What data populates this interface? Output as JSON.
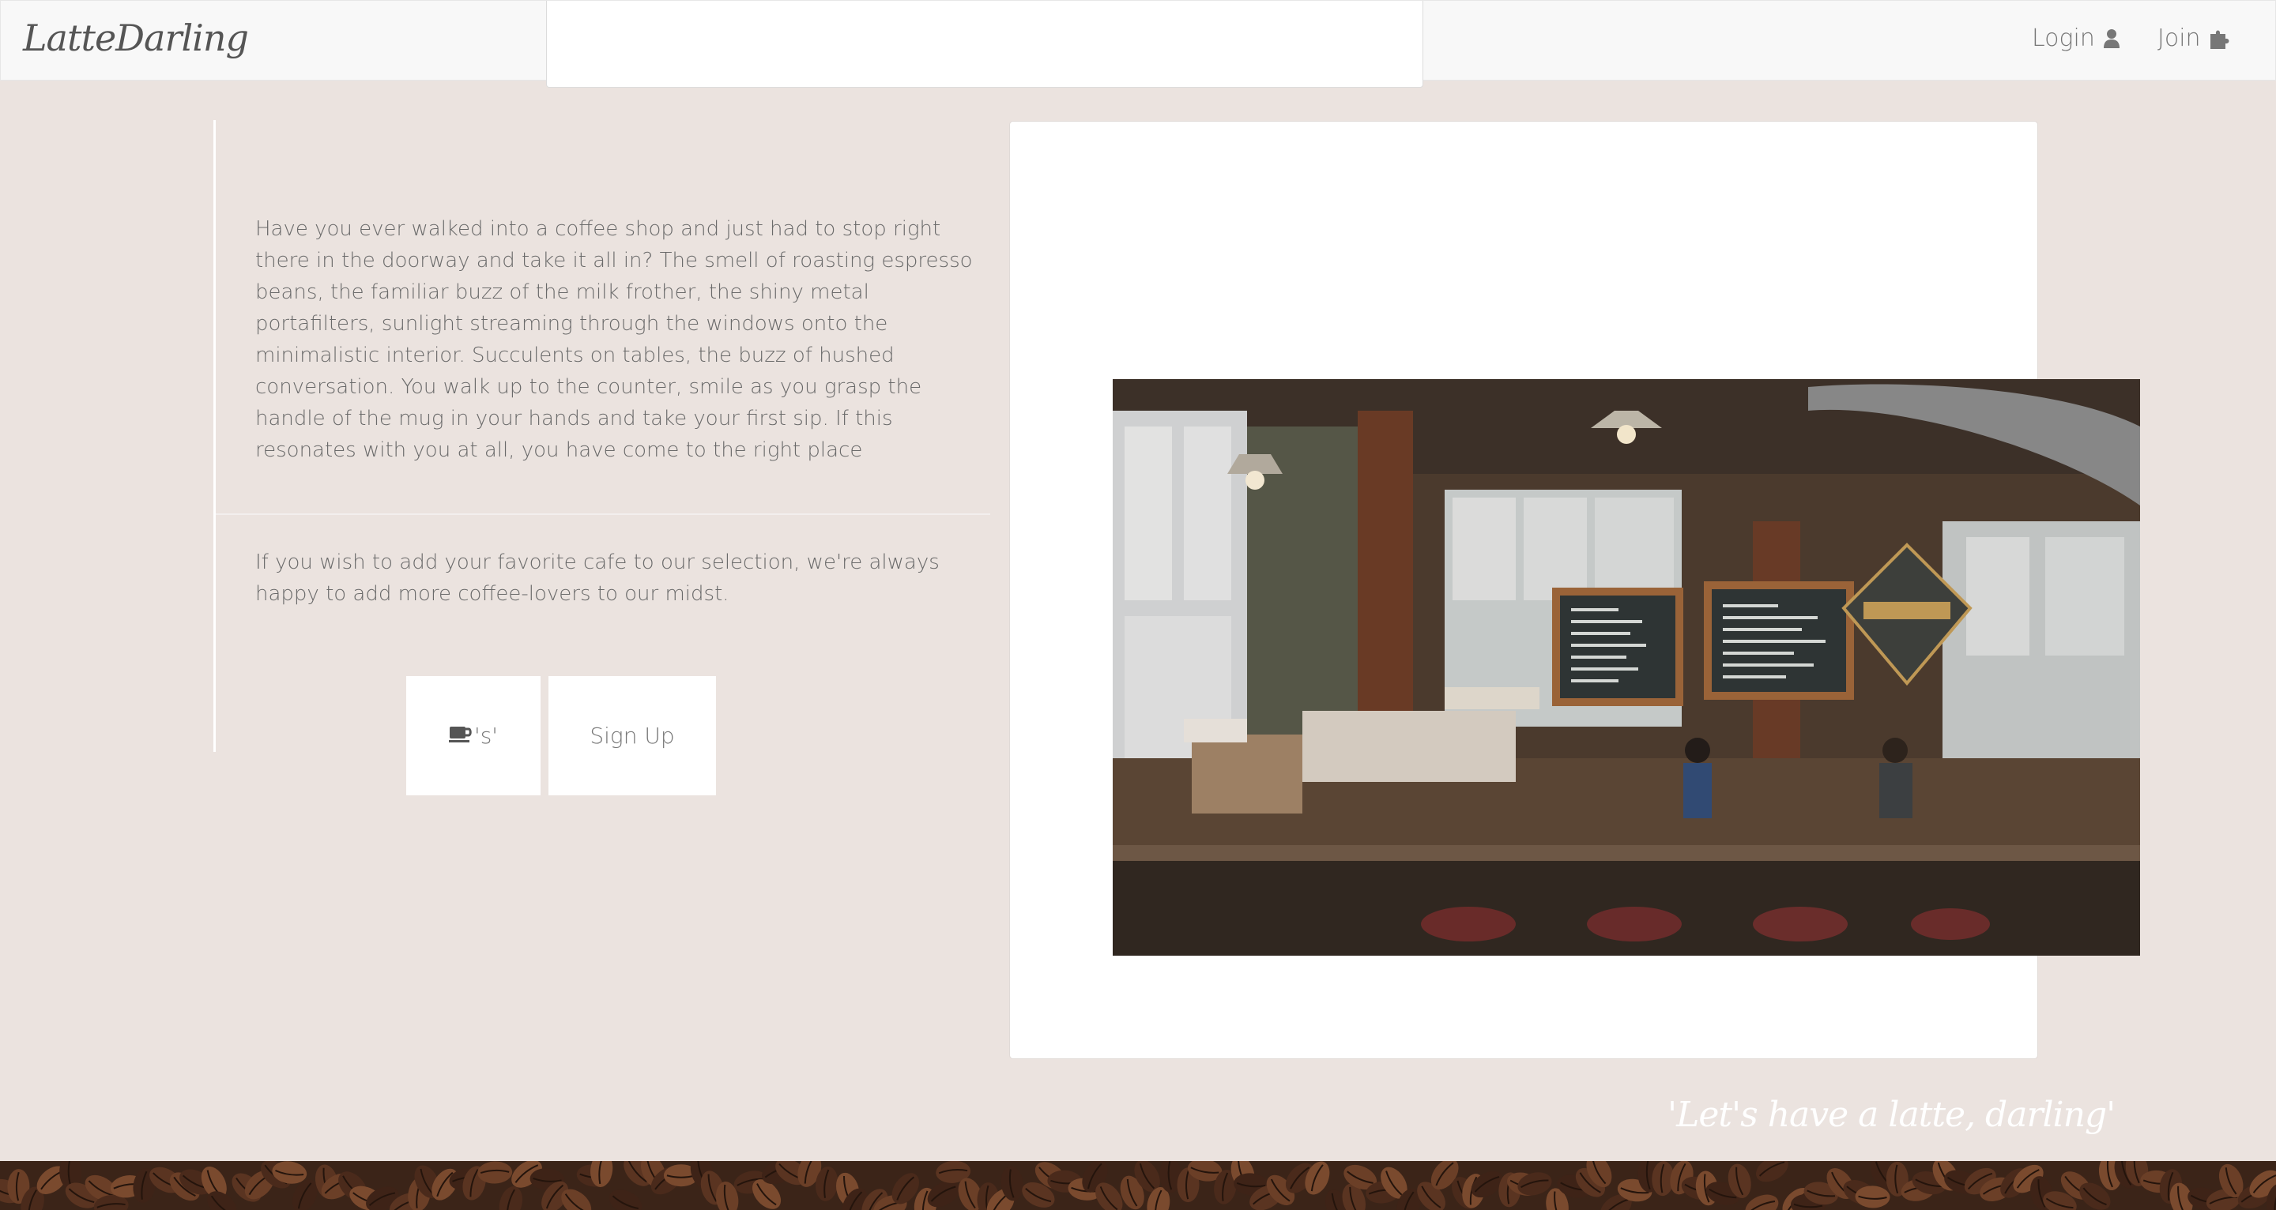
{
  "navbar": {
    "brand": "LatteDarling",
    "login_label": "Login",
    "join_label": "Join",
    "login_icon": "user-icon",
    "join_icon": "puzzle-piece-icon"
  },
  "intro": {
    "paragraph": "Have you ever walked into a coffee shop and just had to stop right there in the doorway and take it all in? The smell of roasting espresso beans, the familiar buzz of the milk frother, the shiny metal portafilters, sunlight streaming through the windows onto the minimalistic interior. Succulents on tables, the buzz of hushed conversation. You walk up to the counter, smile as you grasp the handle of the mug in your hands and take your first sip. If this resonates with you at all, you have come to the right place",
    "invite": "If you wish to add your favorite cafe to our selection, we're always happy to add more coffee-lovers to our midst."
  },
  "buttons": {
    "cafes_suffix": "'s'",
    "cafes_icon": "coffee-cup-icon",
    "signup_label": "Sign Up"
  },
  "tagline": "'Let's have a latte, darling'",
  "colors": {
    "page_background": "#ebe3df",
    "navbar_background": "#f8f8f8",
    "panel_background": "#ffffff",
    "footer_beans": "#3b2418"
  }
}
